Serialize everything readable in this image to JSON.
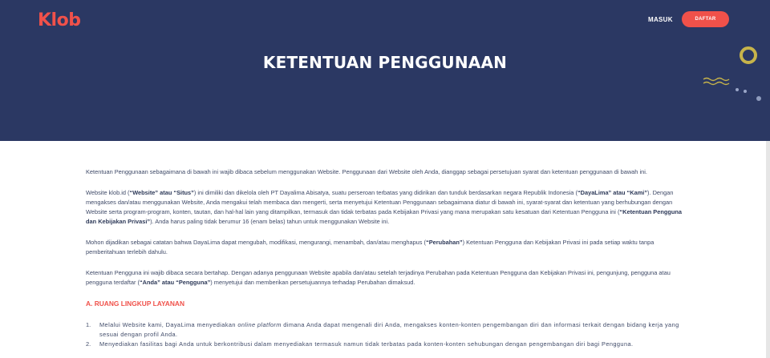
{
  "header": {
    "logo": "Klob",
    "login_label": "MASUK",
    "register_label": "DAFTAR",
    "page_title": "KETENTUAN PENGGUNAAN"
  },
  "colors": {
    "hero_background": "#2b3863",
    "brand_red": "#f0514a",
    "accent_gold": "#c7b44a"
  },
  "content": {
    "p1": "Ketentuan Penggunaan sebagaimana di bawah ini wajib dibaca sebelum menggunakan Website. Penggunaan dari Website oleh Anda, dianggap sebagai persetujuan syarat dan ketentuan penggunaan di bawah ini.",
    "p2_a": "Website klob.id (",
    "p2_b1": "“Website” atau “Situs”",
    "p2_c": ") ini dimiliki dan dikelola oleh PT Dayalima Abisatya, suatu perseroan terbatas yang didirikan dan tunduk berdasarkan negara Republik Indonesia (",
    "p2_b2": "“DayaLima” atau “Kami”",
    "p2_d": "). Dengan mengakses dan/atau menggunakan Website, Anda mengakui telah membaca dan mengerti, serta menyetujui Ketentuan Penggunaan sebagaimana diatur di bawah ini, syarat-syarat dan ketentuan yang berhubungan dengan Website serta program-program, konten, tautan, dan hal-hal lain yang ditampilkan, termasuk dan tidak terbatas pada Kebijakan Privasi yang mana merupakan satu kesatuan dari Ketentuan Pengguna ini (",
    "p2_b3": "“Ketentuan Pengguna dan Kebijakan Privasi”",
    "p2_e": "). Anda harus paling tidak berumur 16 (enam belas) tahun untuk menggunakan Website ini.",
    "p3_a": "Mohon dijadikan sebagai catatan bahwa DayaLima dapat mengubah, modifikasi, mengurangi, menambah, dan/atau menghapus (",
    "p3_b": "“Perubahan”",
    "p3_c": ") Ketentuan Pengguna dan Kebijakan Privasi ini pada setiap waktu tanpa pemberitahuan terlebih dahulu.",
    "p4_a": "Ketentuan Pengguna ini wajib dibaca secara bertahap. Dengan adanya penggunaan Website apabila dan/atau setelah terjadinya Perubahan pada Ketentuan Pengguna dan Kebijakan Privasi ini, pengunjung, pengguna atau pengguna terdaftar (",
    "p4_b": "“Anda” atau “Pengguna”",
    "p4_c": ") menyetujui dan memberikan persetujuannya terhadap Perubahan dimaksud.",
    "section_a_title": "A. RUANG LINGKUP LAYANAN",
    "list": [
      {
        "num": "1.",
        "text_a": "Melalui Website kami, DayaLima menyediakan ",
        "text_em": "online platform",
        "text_b": " dimana Anda dapat mengenali diri Anda, mengakses konten-konten pengembangan diri dan informasi terkait dengan bidang kerja yang sesuai dengan profil Anda."
      },
      {
        "num": "2.",
        "text_a": "Menyediakan fasilitas bagi Anda untuk berkontribusi dalam menyediakan termasuk namun tidak terbatas pada konten-konten sehubungan dengan pengembangan diri bagi Pengguna.",
        "text_em": "",
        "text_b": ""
      }
    ]
  }
}
